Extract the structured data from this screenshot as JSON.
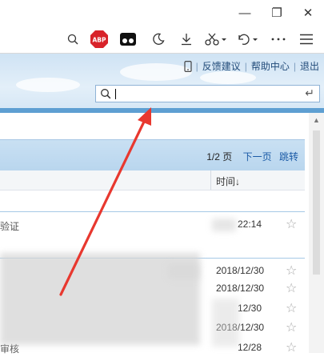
{
  "window": {
    "minimize": "—",
    "restore": "❐",
    "close": "✕"
  },
  "toolbar": {
    "abp": "ABP"
  },
  "header": {
    "links": [
      "反馈建议",
      "帮助中心",
      "退出"
    ],
    "search": {
      "value": "",
      "enter_glyph": "↵"
    }
  },
  "list": {
    "pager": {
      "page": "1/2 页",
      "next": "下一页",
      "jump": "跳转"
    },
    "columns": {
      "time": "时间↓"
    },
    "rows": [
      {
        "snippet": "验证",
        "date": "22:14",
        "star": "☆"
      },
      {
        "snippet": "",
        "date": "2018/12/30",
        "star": "☆"
      },
      {
        "snippet": "",
        "date": "2018/12/30",
        "star": "☆"
      },
      {
        "snippet": "",
        "date": "12/30",
        "star": "☆"
      },
      {
        "snippet": "",
        "date": "2018/12/30",
        "star": "☆"
      },
      {
        "snippet": "审核",
        "date": "12/28",
        "star": "☆"
      }
    ]
  },
  "colors": {
    "accent": "#5e9fd2",
    "arrow": "#e8382f",
    "link": "#1a5aa6"
  }
}
